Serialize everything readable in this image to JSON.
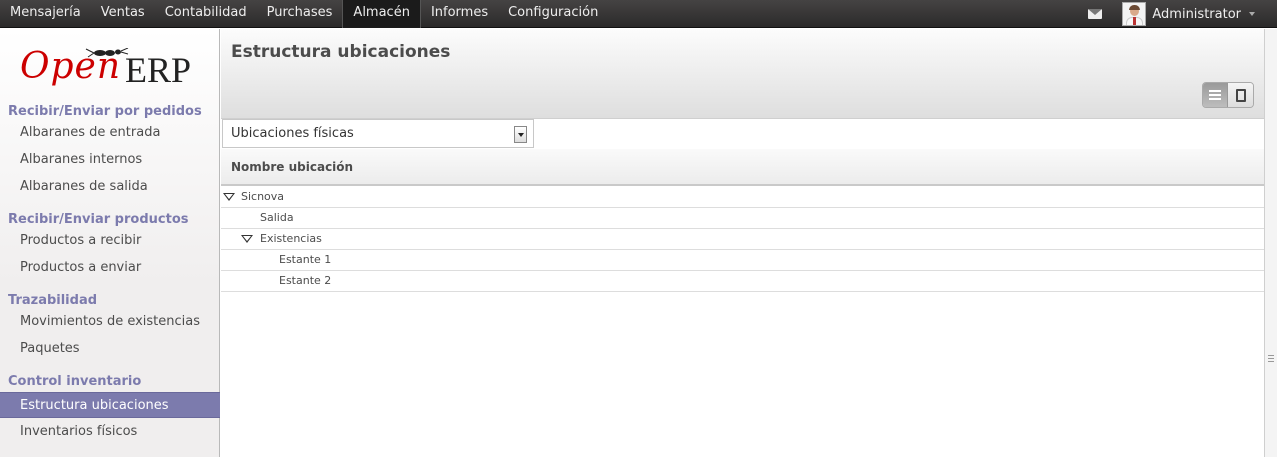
{
  "topbar": {
    "menu": [
      "Mensajería",
      "Ventas",
      "Contabilidad",
      "Purchases",
      "Almacén",
      "Informes",
      "Configuración"
    ],
    "active_menu": "Almacén",
    "user_name": "Administrator"
  },
  "sidebar": {
    "logo": {
      "open": "Open",
      "erp": "ERP"
    },
    "sections": [
      {
        "title": "Recibir/Enviar por pedidos",
        "items": [
          "Albaranes de entrada",
          "Albaranes internos",
          "Albaranes de salida"
        ]
      },
      {
        "title": "Recibir/Enviar productos",
        "items": [
          "Productos a recibir",
          "Productos a enviar"
        ]
      },
      {
        "title": "Trazabilidad",
        "items": [
          "Movimientos de existencias",
          "Paquetes"
        ]
      },
      {
        "title": "Control inventario",
        "items": [
          "Estructura ubicaciones",
          "Inventarios físicos"
        ]
      }
    ],
    "active_item": "Estructura ubicaciones"
  },
  "main": {
    "title": "Estructura ubicaciones",
    "filter_select": "Ubicaciones físicas",
    "column_header": "Nombre ubicación",
    "rows": [
      {
        "label": "Sicnova",
        "expanded": true
      },
      {
        "label": "Salida",
        "expanded": false
      },
      {
        "label": "Existencias",
        "expanded": true
      },
      {
        "label": "Estante 1",
        "expanded": false
      },
      {
        "label": "Estante 2",
        "expanded": false
      }
    ]
  },
  "colors": {
    "accent": "#7c7bad",
    "topbar": "#333333",
    "logo_red": "#cc0000"
  }
}
